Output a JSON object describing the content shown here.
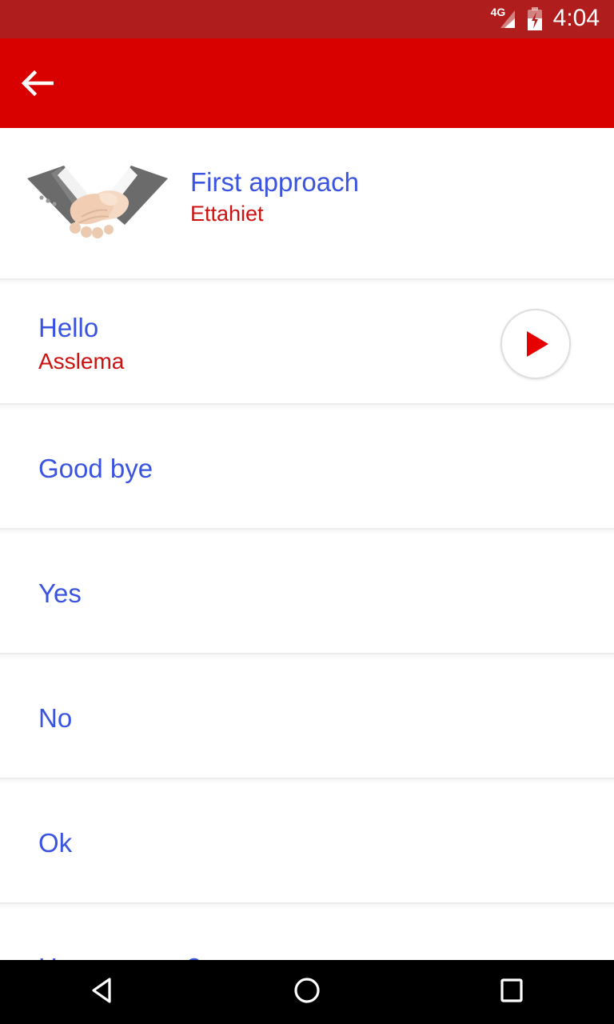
{
  "status_bar": {
    "network_label": "4G",
    "time": "4:04",
    "signal_icon": "signal-bars-icon",
    "battery_icon": "battery-charging-icon",
    "background_color": "#b01d1d"
  },
  "app_bar": {
    "back_icon": "arrow-back-icon",
    "background_color": "#d90000"
  },
  "header": {
    "image_icon": "handshake-illustration",
    "title": "First approach",
    "subtitle": "Ettahiet",
    "title_color": "#3b54e0",
    "subtitle_color": "#cc1111"
  },
  "phrases": [
    {
      "title": "Hello",
      "translation": "Asslema",
      "has_audio": true,
      "play_icon": "play-icon"
    },
    {
      "title": "Good bye",
      "translation": "",
      "has_audio": false
    },
    {
      "title": "Yes",
      "translation": "",
      "has_audio": false
    },
    {
      "title": "No",
      "translation": "",
      "has_audio": false
    },
    {
      "title": "Ok",
      "translation": "",
      "has_audio": false
    },
    {
      "title": "How are you?",
      "translation": "",
      "has_audio": false
    }
  ],
  "nav_bar": {
    "back_icon": "nav-back-triangle-icon",
    "home_icon": "nav-home-circle-icon",
    "recents_icon": "nav-recents-square-icon",
    "background_color": "#000000"
  }
}
